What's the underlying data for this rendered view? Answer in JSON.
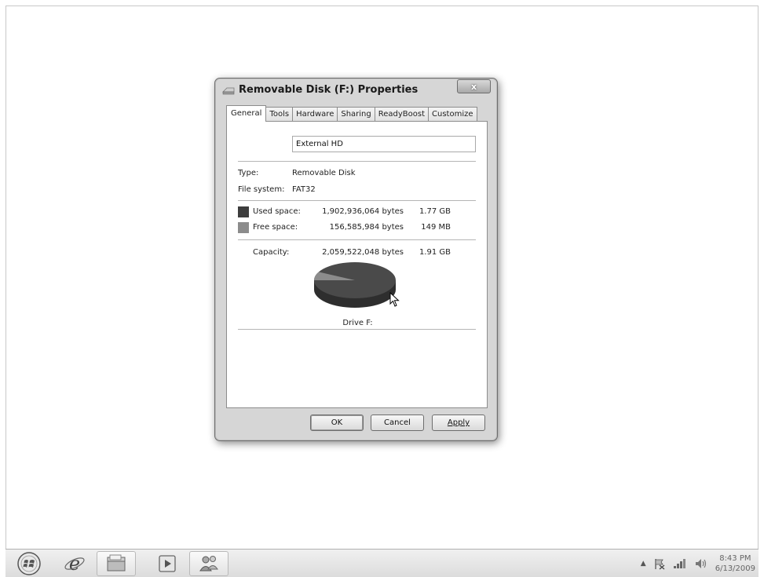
{
  "window": {
    "title": "Removable Disk (F:) Properties",
    "close_label": "x"
  },
  "tabs": [
    "General",
    "Tools",
    "Hardware",
    "Sharing",
    "ReadyBoost",
    "Customize"
  ],
  "active_tab": "General",
  "general": {
    "volume_name": "External HD",
    "type_label": "Type:",
    "type_value": "Removable Disk",
    "fs_label": "File system:",
    "fs_value": "FAT32",
    "used_label": "Used space:",
    "used_bytes": "1,902,936,064 bytes",
    "used_size": "1.77 GB",
    "free_label": "Free space:",
    "free_bytes": "156,585,984 bytes",
    "free_size": "149 MB",
    "capacity_label": "Capacity:",
    "capacity_bytes": "2,059,522,048 bytes",
    "capacity_size": "1.91 GB",
    "drive_label": "Drive F:",
    "used_color": "#3d3d3d",
    "free_color": "#8c8c8c",
    "used_fraction": 0.924
  },
  "buttons": {
    "ok": "OK",
    "cancel": "Cancel",
    "apply": "Apply"
  },
  "taskbar": {
    "items": [
      "start-orb",
      "internet-explorer",
      "windows-explorer",
      "media-player",
      "people"
    ],
    "tray_time": "8:43 PM",
    "tray_date": "6/13/2009"
  }
}
